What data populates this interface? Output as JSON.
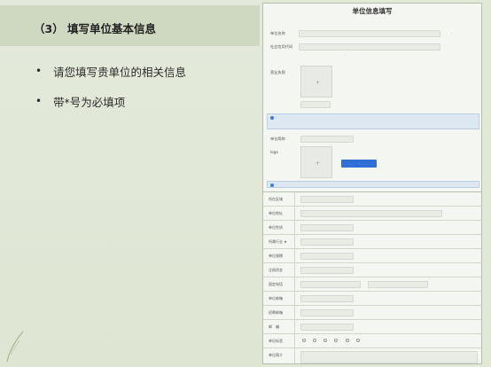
{
  "slide": {
    "title": "（3） 填写单位基本信息",
    "bullets": [
      "请您填写贵单位的相关信息",
      "带*号为必填项"
    ]
  },
  "form": {
    "header": "单位信息填写",
    "unit_name": {
      "label": "单位名称",
      "placeholder": "·",
      "link": "·"
    },
    "credit_code": {
      "label": "社会信用代码",
      "placeholder": "·"
    },
    "radio_hint": "·",
    "license": {
      "label": "营业执照",
      "sample_label": "·"
    },
    "info1": "·",
    "unit_short": {
      "label": "单位简称",
      "placeholder": "·"
    },
    "logo": {
      "label": "logo",
      "button": "·"
    },
    "info2": "·",
    "table_rows": [
      {
        "label": "所在区域",
        "placeholder": "·"
      },
      {
        "label": "单位地址",
        "value": "·"
      },
      {
        "label": "单位性质",
        "placeholder": "·"
      },
      {
        "label": "所属行业 ★",
        "placeholder": "·"
      },
      {
        "label": "单位规模",
        "placeholder": "·"
      },
      {
        "label": "注册资金",
        "placeholder": "·"
      },
      {
        "label": "固定电话",
        "placeholder": "·",
        "placeholder2": "·"
      },
      {
        "label": "单位邮箱",
        "placeholder": "·"
      },
      {
        "label": "招聘邮箱",
        "placeholder": "·"
      },
      {
        "label": "邮　编",
        "placeholder": "·"
      }
    ],
    "unit_tags": {
      "label": "单位标签",
      "options": [
        "·",
        "·",
        "·",
        "·",
        "·",
        "·"
      ]
    },
    "unit_intro": {
      "label": "单位简介",
      "placeholder": "·",
      "counter": "·"
    }
  },
  "colors": {
    "accent": "#2f6fd6",
    "title_band": "#cfd8c0",
    "background": "#e2e8d6"
  }
}
